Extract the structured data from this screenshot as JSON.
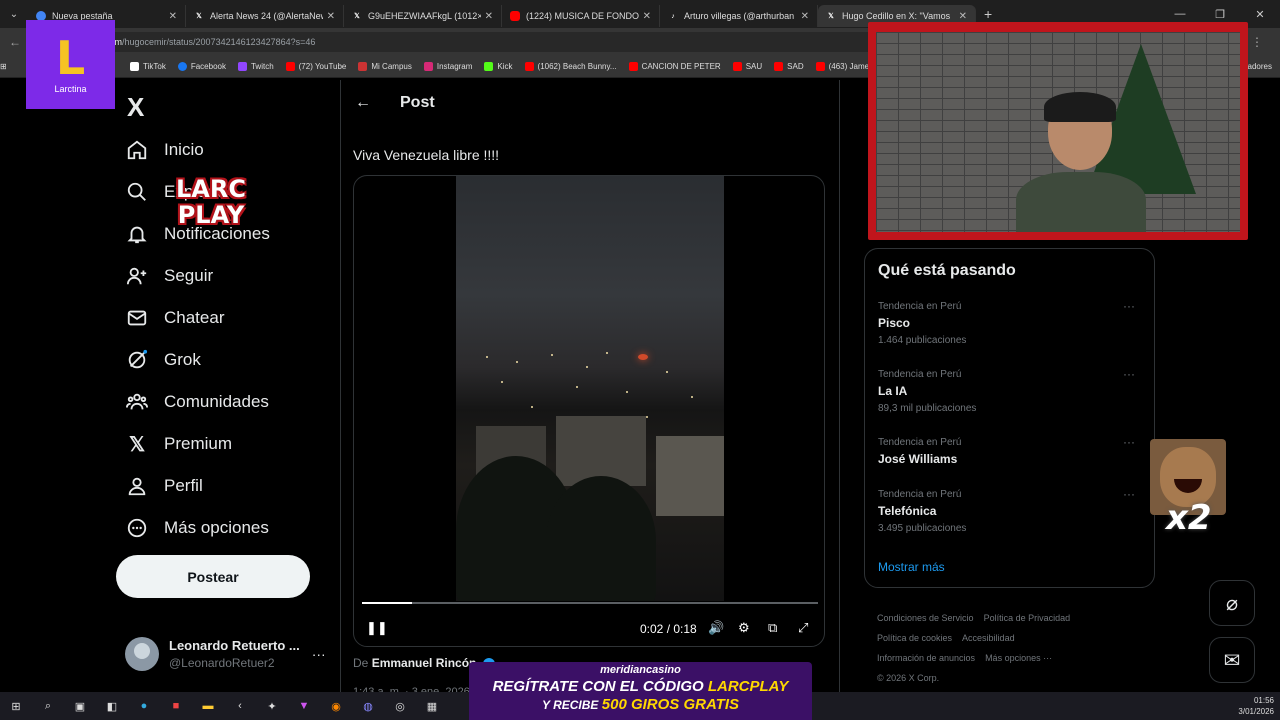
{
  "browser": {
    "tabs": [
      {
        "label": "Nueva pestaña",
        "icon": "chrome-icon",
        "active": false
      },
      {
        "label": "Alerta News 24 (@AlertaNews24",
        "icon": "x-icon",
        "active": false
      },
      {
        "label": "G9uEHEZWIAAFkgL (1012×179",
        "icon": "x-icon",
        "active": false
      },
      {
        "label": "(1224) MUSICA DE FONDO PAR",
        "icon": "youtube-icon",
        "active": false
      },
      {
        "label": "Arturo villegas (@arthurban",
        "icon": "tiktok-icon",
        "active": false
      },
      {
        "label": "Hugo Cedillo en X: \"Vamos",
        "icon": "x-icon",
        "active": true
      }
    ],
    "url_prefix": "x.com",
    "url": "/hugocemir/status/2007342146123427864?s=46",
    "bookmarks": [
      {
        "label": "TikTok",
        "color": "#ffffff"
      },
      {
        "label": "Facebook",
        "color": "#1877f2"
      },
      {
        "label": "Twitch",
        "color": "#9146ff"
      },
      {
        "label": "(72) YouTube",
        "color": "#ff0000"
      },
      {
        "label": "Mi Campus",
        "color": "#cc3333"
      },
      {
        "label": "Instagram",
        "color": "#d62976"
      },
      {
        "label": "Kick",
        "color": "#53fc18"
      },
      {
        "label": "(1062) Beach Bunny...",
        "color": "#ff0000"
      },
      {
        "label": "CANCION DE PETER",
        "color": "#ff0000"
      },
      {
        "label": "SAU",
        "color": "#ff0000"
      },
      {
        "label": "SAD",
        "color": "#ff0000"
      },
      {
        "label": "(463) James Arthur -...",
        "color": "#ff0000"
      }
    ],
    "bookmarks_right": "adores"
  },
  "overlay_logo": {
    "letter": "L",
    "label": "Larctina"
  },
  "sidebar": {
    "logo": "X",
    "items": [
      {
        "label": "Inicio",
        "icon": "home-icon"
      },
      {
        "label": "Explorar",
        "icon": "search-icon"
      },
      {
        "label": "Notificaciones",
        "icon": "bell-icon"
      },
      {
        "label": "Seguir",
        "icon": "follow-icon"
      },
      {
        "label": "Chatear",
        "icon": "mail-icon"
      },
      {
        "label": "Grok",
        "icon": "grok-icon"
      },
      {
        "label": "Comunidades",
        "icon": "communities-icon"
      },
      {
        "label": "Premium",
        "icon": "x-premium-icon"
      },
      {
        "label": "Perfil",
        "icon": "person-icon"
      },
      {
        "label": "Más opciones",
        "icon": "more-icon"
      }
    ],
    "post_button": "Postear",
    "profile": {
      "name": "Leonardo Retuerto ...",
      "handle": "@LeonardoRetuer2"
    }
  },
  "main": {
    "header": "Post",
    "tweet_text": "Viva Venezuela libre !!!!",
    "video": {
      "time": "0:02 / 0:18",
      "progress": 0.11
    },
    "author_prefix": "De",
    "author": "Emmanuel Rincón",
    "timestamp": "1:43 a. m. · 3 ene. 2026"
  },
  "trends": {
    "title": "Qué está pasando",
    "items": [
      {
        "category": "Tendencia en Perú",
        "name": "Pisco",
        "posts": "1.464 publicaciones"
      },
      {
        "category": "Tendencia en Perú",
        "name": "La IA",
        "posts": "89,3 mil publicaciones"
      },
      {
        "category": "Tendencia en Perú",
        "name": "José Williams",
        "posts": ""
      },
      {
        "category": "Tendencia en Perú",
        "name": "Telefónica",
        "posts": "3.495 publicaciones"
      }
    ],
    "show_more": "Mostrar más"
  },
  "footer": {
    "links": [
      "Condiciones de Servicio",
      "Política de Privacidad",
      "Política de cookies",
      "Accesibilidad",
      "Información de anuncios",
      "Más opciones ···"
    ],
    "copyright": "© 2026 X Corp."
  },
  "stream": {
    "logo_line1": "LARC",
    "logo_line2": "PLAY",
    "meme_text": "x2"
  },
  "ad": {
    "brand": "meridiancasino",
    "line1_prefix": "REGÍTRATE CON EL CÓDIGO",
    "line1_code": "LARCPLAY",
    "line2_prefix": "Y RECIBE",
    "line2_offer": "500 GIROS GRATIS"
  },
  "taskbar": {
    "time": "01:56",
    "date": "3/01/2026"
  }
}
